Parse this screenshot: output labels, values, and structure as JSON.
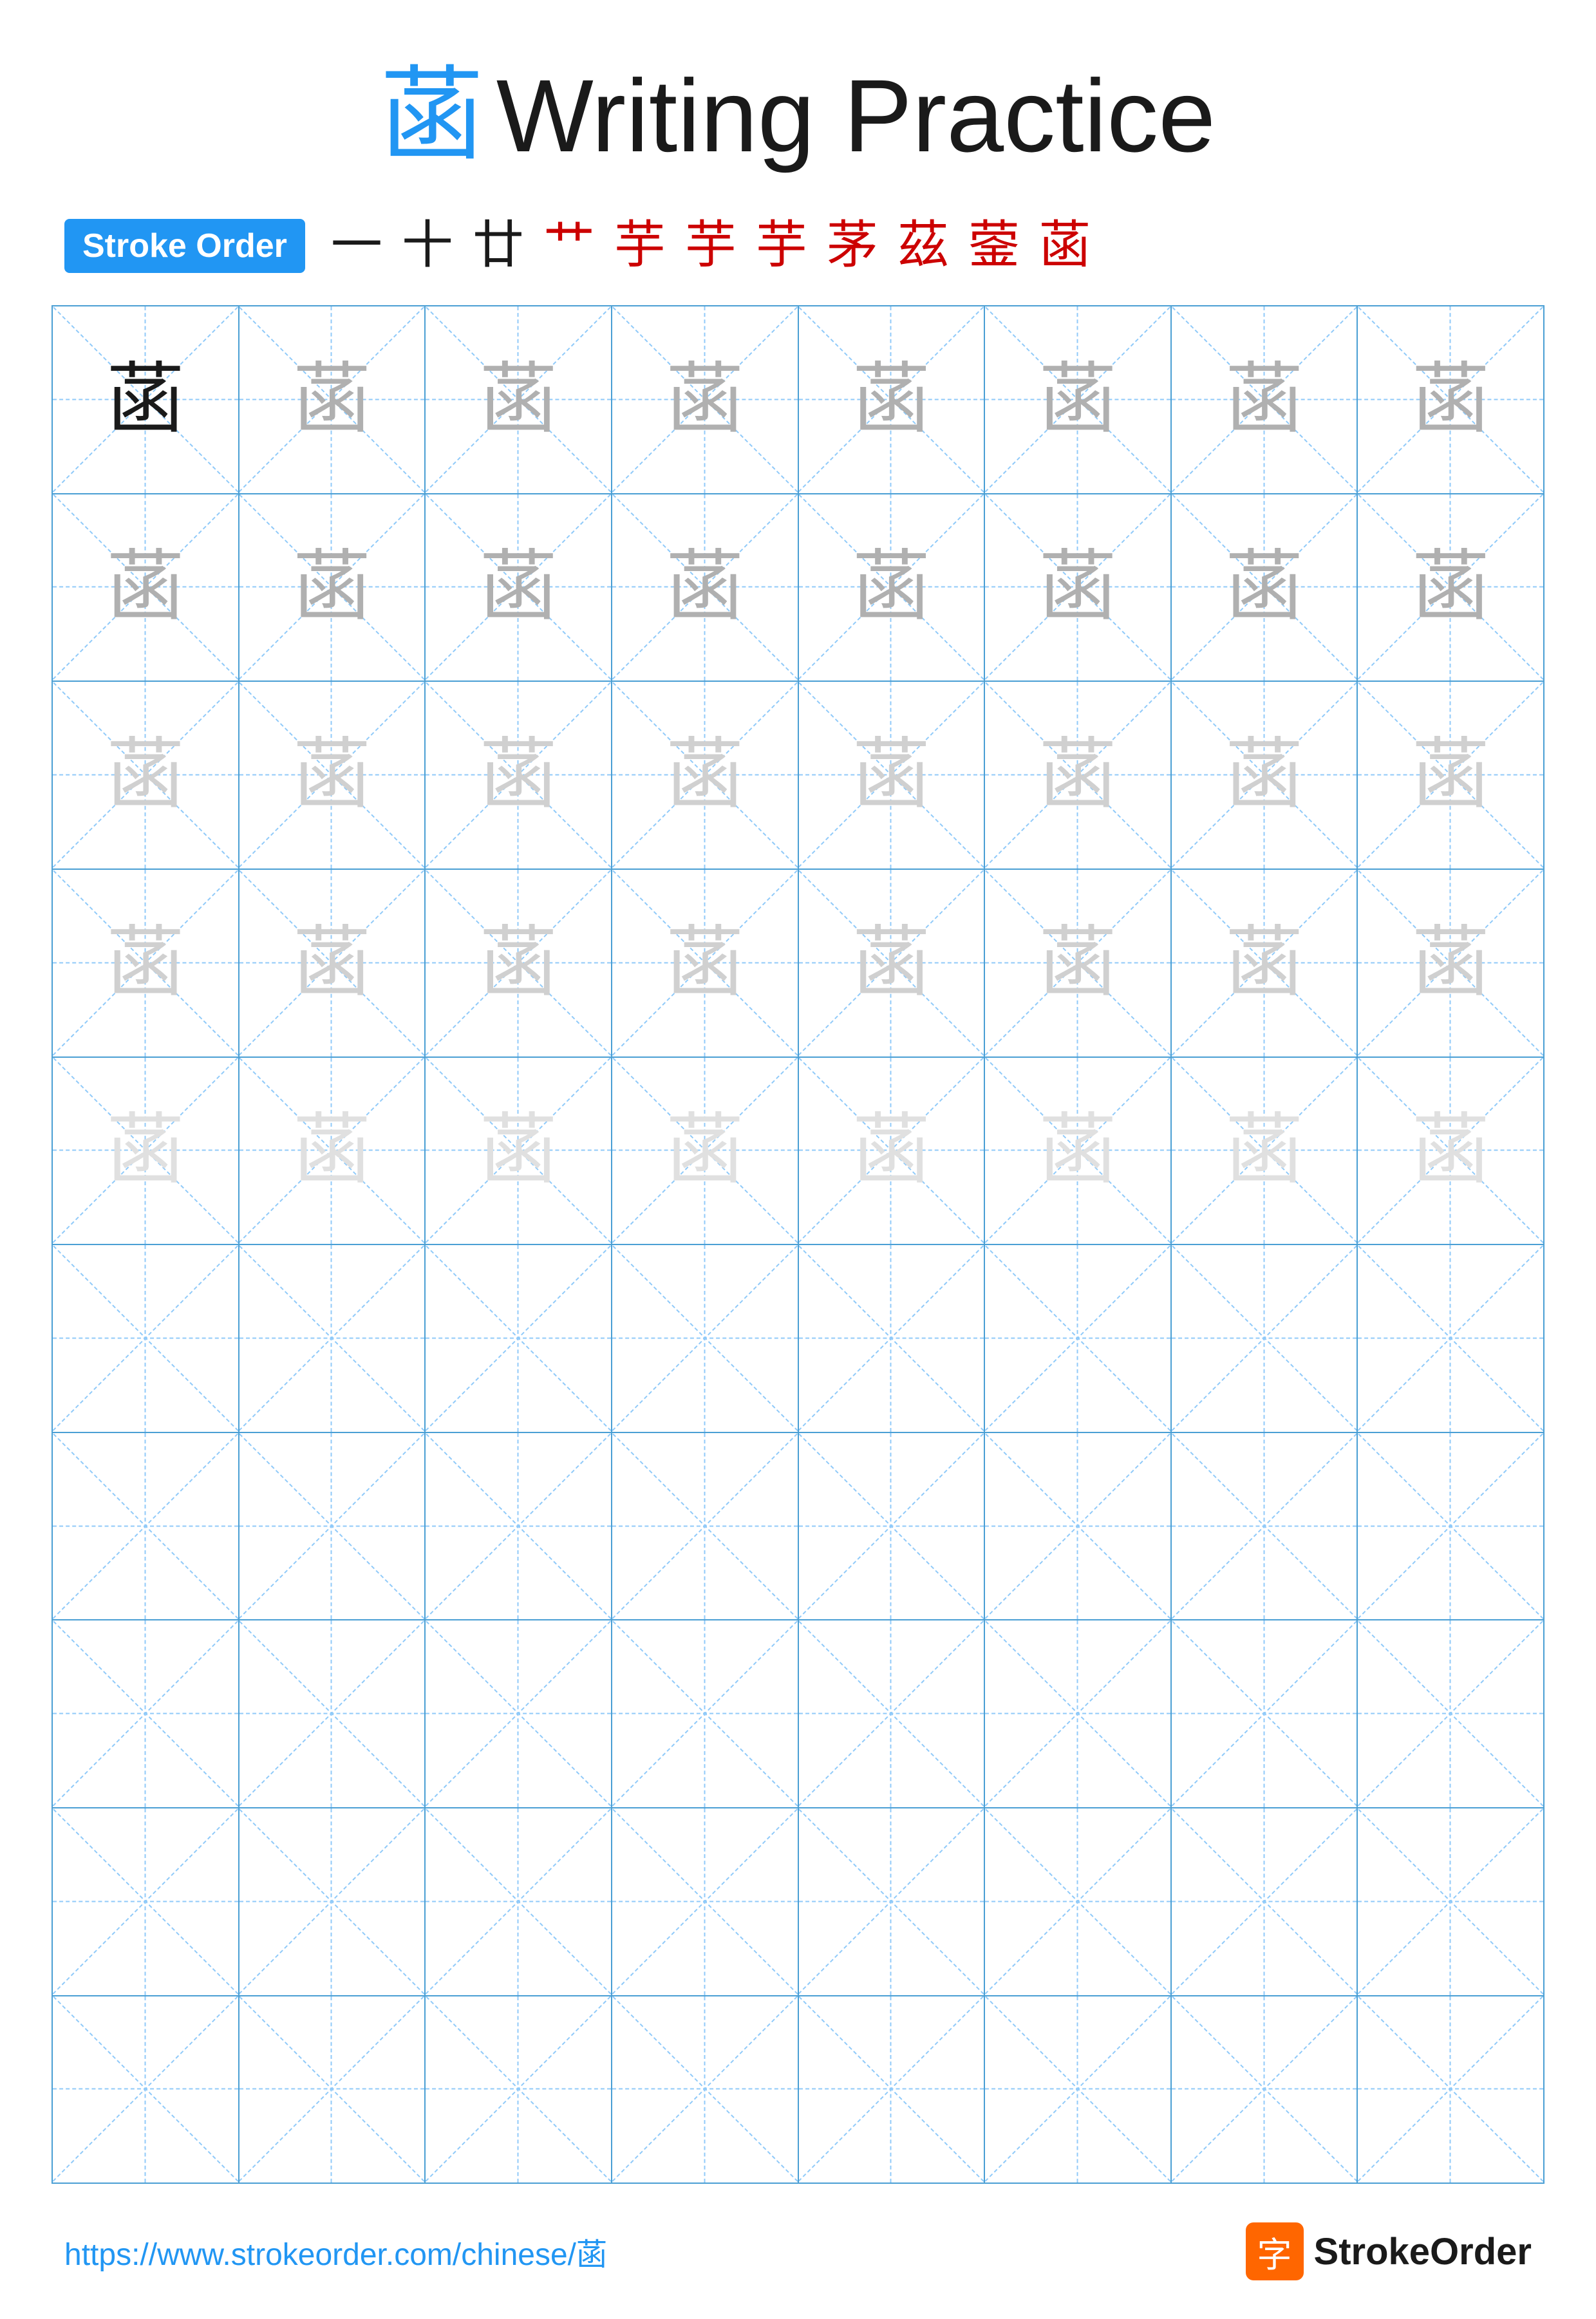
{
  "title": {
    "char": "菡",
    "text": "Writing Practice"
  },
  "stroke_order": {
    "badge_label": "Stroke Order",
    "strokes": [
      {
        "char": "一",
        "color": "black"
      },
      {
        "char": "十",
        "color": "black"
      },
      {
        "char": "廿",
        "color": "black"
      },
      {
        "char": "艹",
        "color": "red"
      },
      {
        "char": "芋",
        "color": "red"
      },
      {
        "char": "芋",
        "color": "red"
      },
      {
        "char": "芋",
        "color": "red"
      },
      {
        "char": "茅",
        "color": "red"
      },
      {
        "char": "茲",
        "color": "red"
      },
      {
        "char": "蓥",
        "color": "red"
      },
      {
        "char": "菡",
        "color": "red"
      }
    ]
  },
  "grid": {
    "rows": 10,
    "cols": 8,
    "character": "菡",
    "filled_rows": [
      {
        "row": 0,
        "chars": [
          {
            "opacity": "dark"
          },
          {
            "opacity": "medium"
          },
          {
            "opacity": "medium"
          },
          {
            "opacity": "medium"
          },
          {
            "opacity": "medium"
          },
          {
            "opacity": "medium"
          },
          {
            "opacity": "medium"
          },
          {
            "opacity": "medium"
          }
        ]
      },
      {
        "row": 1,
        "chars": [
          {
            "opacity": "medium"
          },
          {
            "opacity": "medium"
          },
          {
            "opacity": "medium"
          },
          {
            "opacity": "medium"
          },
          {
            "opacity": "medium"
          },
          {
            "opacity": "medium"
          },
          {
            "opacity": "medium"
          },
          {
            "opacity": "medium"
          }
        ]
      },
      {
        "row": 2,
        "chars": [
          {
            "opacity": "light"
          },
          {
            "opacity": "light"
          },
          {
            "opacity": "light"
          },
          {
            "opacity": "light"
          },
          {
            "opacity": "light"
          },
          {
            "opacity": "light"
          },
          {
            "opacity": "light"
          },
          {
            "opacity": "light"
          }
        ]
      },
      {
        "row": 3,
        "chars": [
          {
            "opacity": "light"
          },
          {
            "opacity": "light"
          },
          {
            "opacity": "light"
          },
          {
            "opacity": "light"
          },
          {
            "opacity": "light"
          },
          {
            "opacity": "light"
          },
          {
            "opacity": "light"
          },
          {
            "opacity": "light"
          }
        ]
      },
      {
        "row": 4,
        "chars": [
          {
            "opacity": "very-light"
          },
          {
            "opacity": "very-light"
          },
          {
            "opacity": "very-light"
          },
          {
            "opacity": "very-light"
          },
          {
            "opacity": "very-light"
          },
          {
            "opacity": "very-light"
          },
          {
            "opacity": "very-light"
          },
          {
            "opacity": "very-light"
          }
        ]
      }
    ],
    "empty_rows": 5
  },
  "footer": {
    "url": "https://www.strokeorder.com/chinese/菡",
    "brand_name": "StrokeOrder",
    "logo_char": "字"
  }
}
